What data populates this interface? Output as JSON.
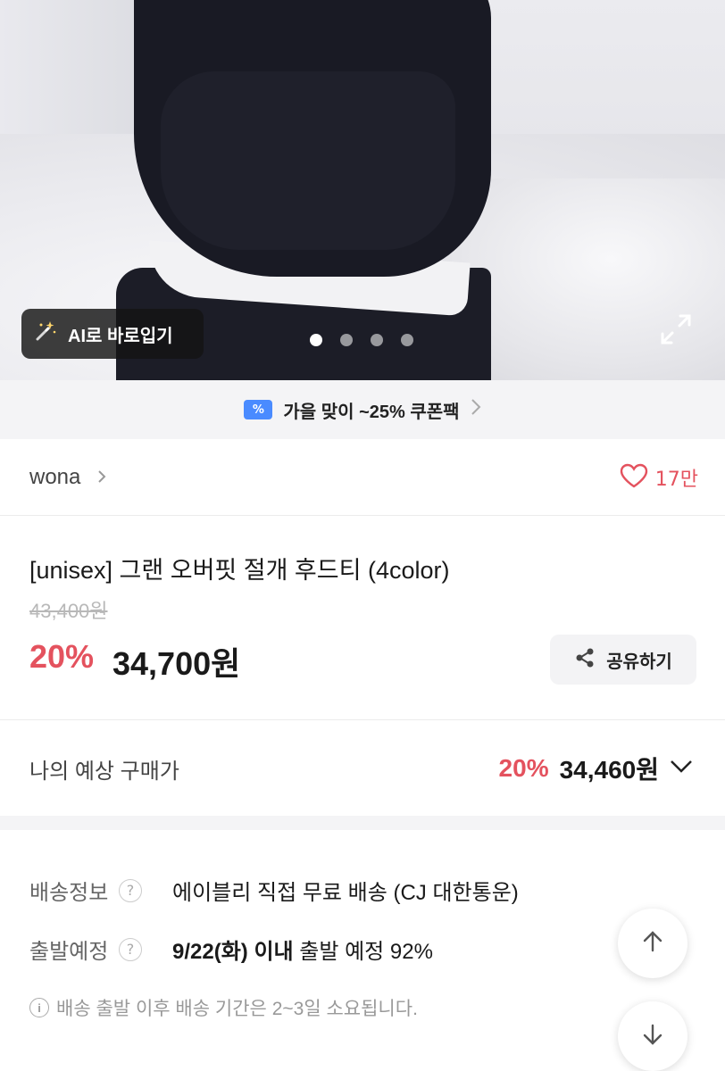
{
  "hero": {
    "ai_button_label": "AI로 바로입기",
    "slide_count": 4,
    "active_slide": 1
  },
  "coupon": {
    "text": "가을 맞이 ~25% 쿠폰팩"
  },
  "seller": {
    "name": "wona",
    "likes": "17만"
  },
  "product": {
    "title": "[unisex] 그랜 오버핏 절개 후드티 (4color)",
    "original_price": "43,400원",
    "discount": "20%",
    "price": "34,700원",
    "share_label": "공유하기"
  },
  "expected_price": {
    "label": "나의 예상 구매가",
    "discount": "20%",
    "amount": "34,460원"
  },
  "shipping": {
    "info_label": "배송정보",
    "info_value": "에이블리 직접 무료 배송 (CJ 대한통운)",
    "departure_label": "출발예정",
    "departure_date": "9/22(화) 이내",
    "departure_rest": " 출발 예정 92%",
    "note": "배송 출발 이후 배송 기간은 2~3일 소요됩니다."
  },
  "colors": {
    "accent": "#e4525e",
    "coupon_icon": "#4a8bff"
  }
}
